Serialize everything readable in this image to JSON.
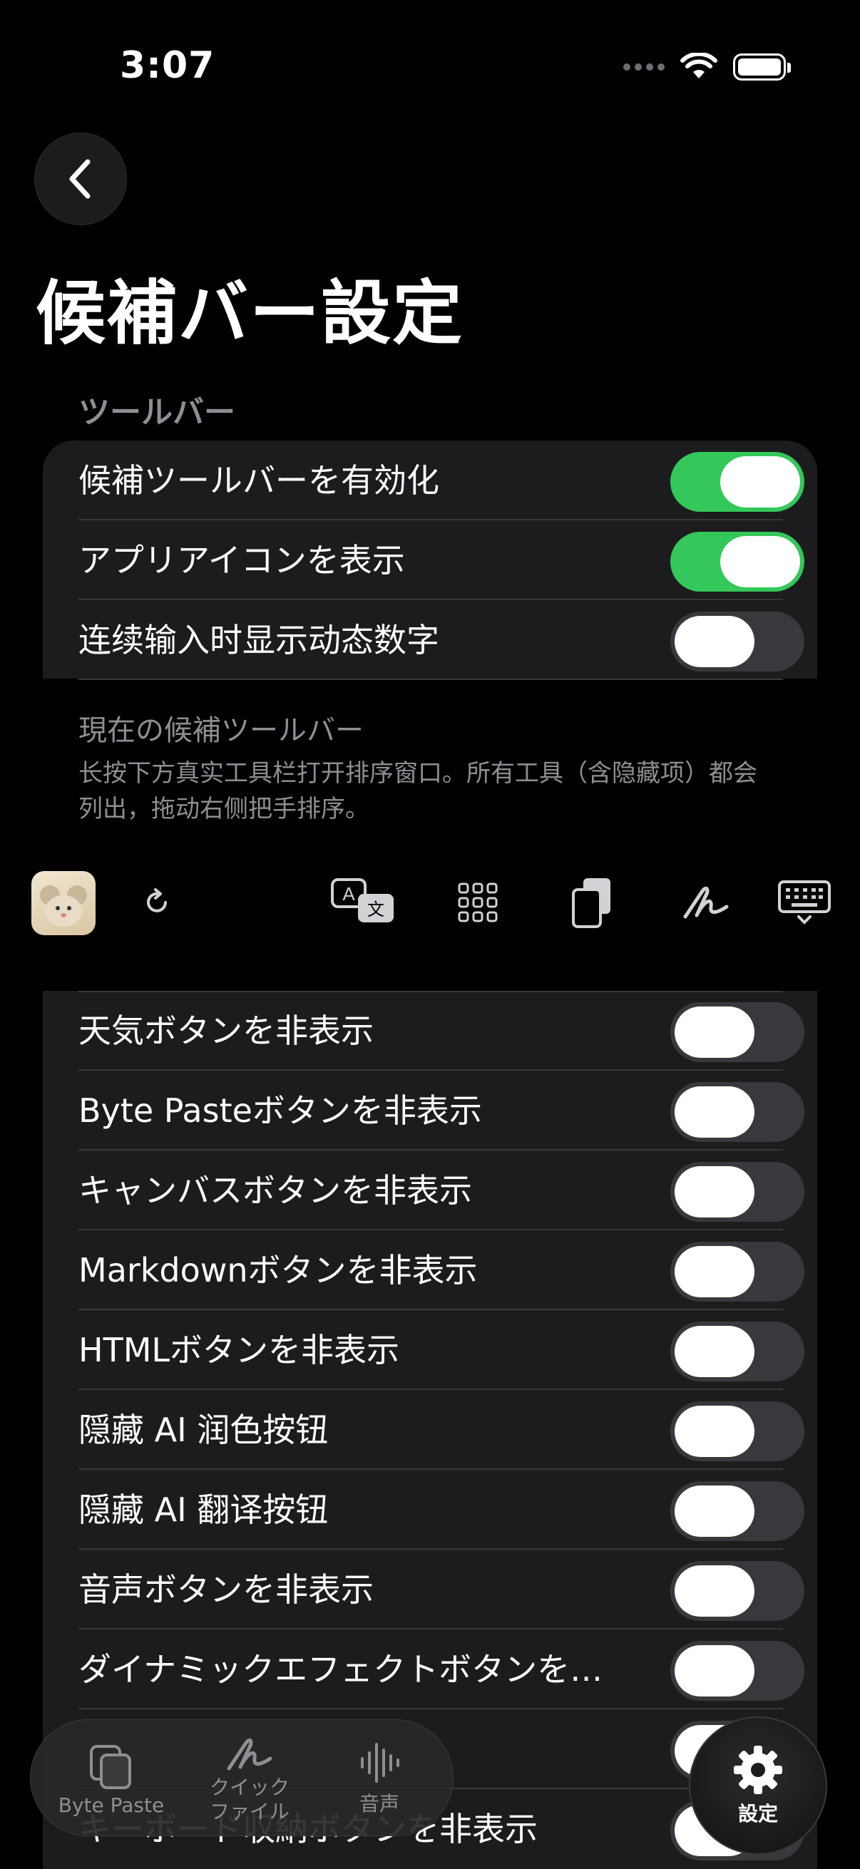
{
  "status_bar": {
    "time": "3:07"
  },
  "page": {
    "title": "候補バー設定"
  },
  "toolbar_section": {
    "header": "ツールバー",
    "rows": [
      {
        "label": "候補ツールバーを有効化",
        "on": true
      },
      {
        "label": "アプリアイコンを表示",
        "on": true
      },
      {
        "label": "连续输入时显示动态数字",
        "on": false
      }
    ]
  },
  "current_toolbar": {
    "title": "現在の候補ツールバー",
    "description": "长按下方真实工具栏打开排序窗口。所有工具（含隐藏项）都会列出，拖动右侧把手排序。",
    "tools": [
      "app-icon",
      "refresh-icon",
      "translate-icon",
      "grid-icon",
      "clipboard-icon",
      "handwriting-icon",
      "keyboard-icon"
    ]
  },
  "hide_section": {
    "rows": [
      {
        "label": "天気ボタンを非表示",
        "on": false
      },
      {
        "label": "Byte Pasteボタンを非表示",
        "on": false
      },
      {
        "label": "キャンバスボタンを非表示",
        "on": false
      },
      {
        "label": "Markdownボタンを非表示",
        "on": false
      },
      {
        "label": "HTMLボタンを非表示",
        "on": false
      },
      {
        "label": "隠藏 AI 润色按钮",
        "on": false
      },
      {
        "label": "隠藏 AI 翻译按钮",
        "on": false
      },
      {
        "label": "音声ボタンを非表示",
        "on": false
      },
      {
        "label": "ダイナミックエフェクトボタンを…",
        "on": false
      },
      {
        "label": "",
        "on": false
      },
      {
        "label": "キーボード収納ボタンを非表示",
        "on": false
      }
    ]
  },
  "tab_bar": {
    "tabs": [
      {
        "label": "Byte Paste",
        "icon": "copy-icon"
      },
      {
        "label": "クイック\nファイル",
        "icon": "handwriting-icon"
      },
      {
        "label": "音声",
        "icon": "waveform-icon"
      }
    ],
    "settings_label": "設定"
  },
  "colors": {
    "accent_on": "#34c759",
    "background": "#000000",
    "card": "#1c1c1e"
  }
}
